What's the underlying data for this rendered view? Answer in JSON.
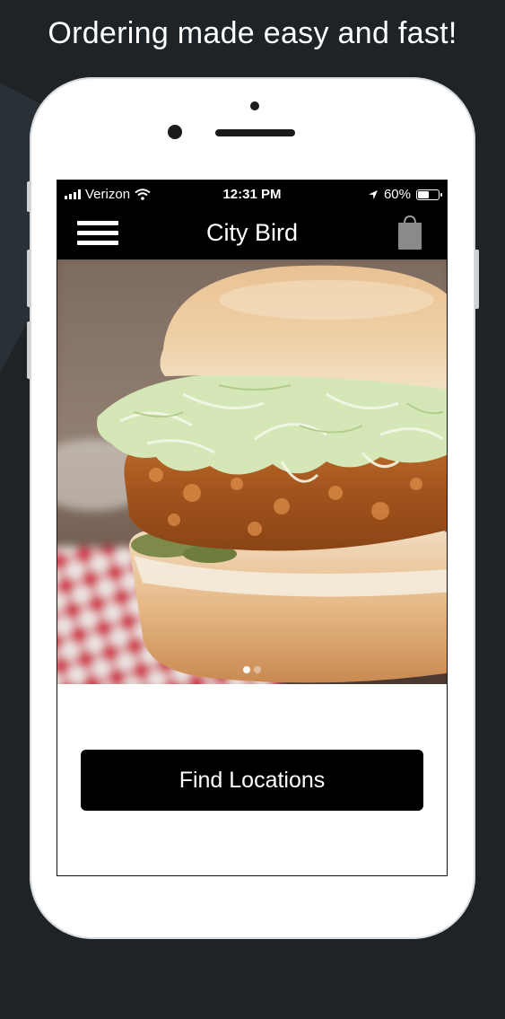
{
  "marketing": {
    "headline": "Ordering made easy and fast!"
  },
  "status_bar": {
    "carrier": "Verizon",
    "time": "12:31 PM",
    "battery_percent_text": "60%",
    "battery_level": 0.6,
    "icons": [
      "signal-bars-icon",
      "wifi-icon",
      "location-arrow-icon",
      "battery-icon"
    ]
  },
  "nav": {
    "title": "City Bird",
    "menu_icon": "hamburger-menu-icon",
    "cart_icon": "shopping-bag-icon"
  },
  "carousel": {
    "image": "fried-chicken-sandwich-photo",
    "page_count": 2,
    "active_index": 0
  },
  "actions": {
    "find_locations_label": "Find Locations"
  },
  "colors": {
    "background": "#1d2327",
    "nav": "#000000",
    "button": "#000000",
    "button_text": "#ffffff"
  }
}
